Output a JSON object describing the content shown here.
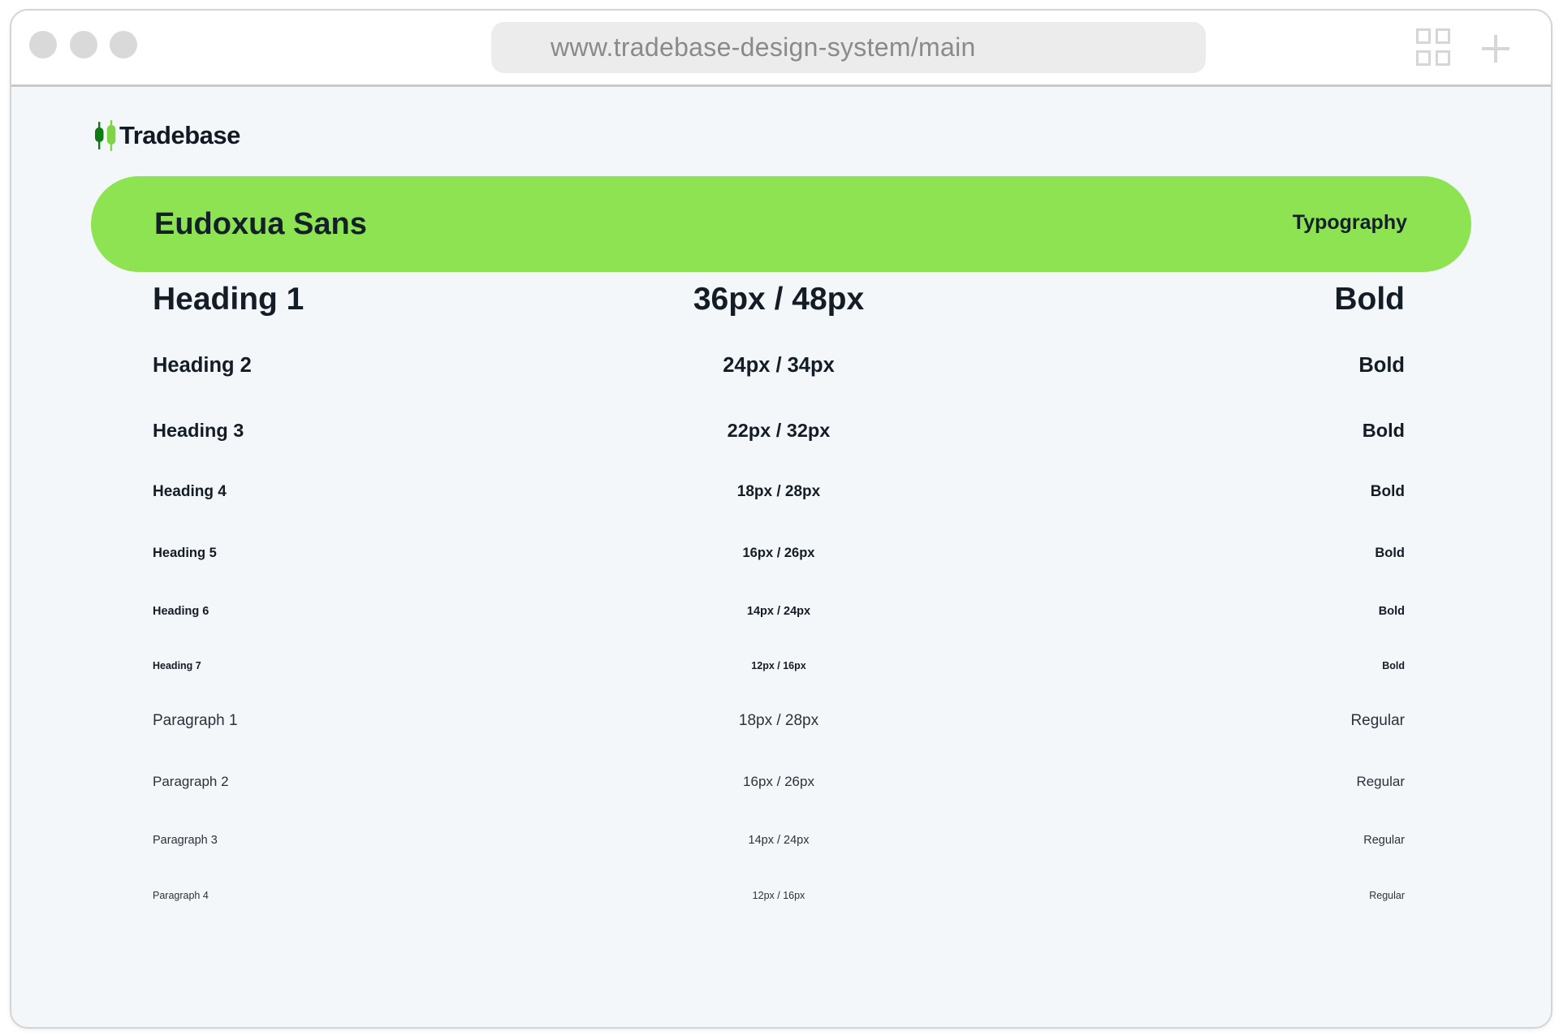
{
  "browser": {
    "url": "www.tradebase-design-system/main",
    "icons": [
      "tabs-grid-icon",
      "new-tab-plus-icon"
    ]
  },
  "brand": {
    "name": "Tradebase",
    "logo_icon": "candlestick-icon",
    "colors": {
      "accent": "#8ee352",
      "logo_dark": "#0f7a12",
      "logo_light": "#7fd548",
      "text": "#141c26"
    }
  },
  "banner": {
    "title": "Eudoxua Sans",
    "tag": "Typography"
  },
  "type_scale": [
    {
      "name": "Heading 1",
      "size": "36px / 48px",
      "weight": "Bold"
    },
    {
      "name": "Heading 2",
      "size": "24px / 34px",
      "weight": "Bold"
    },
    {
      "name": "Heading 3",
      "size": "22px / 32px",
      "weight": "Bold"
    },
    {
      "name": "Heading 4",
      "size": "18px / 28px",
      "weight": "Bold"
    },
    {
      "name": "Heading 5",
      "size": "16px / 26px",
      "weight": "Bold"
    },
    {
      "name": "Heading 6",
      "size": "14px / 24px",
      "weight": "Bold"
    },
    {
      "name": "Heading 7",
      "size": "12px / 16px",
      "weight": "Bold"
    },
    {
      "name": "Paragraph 1",
      "size": "18px / 28px",
      "weight": "Regular"
    },
    {
      "name": "Paragraph 2",
      "size": "16px / 26px",
      "weight": "Regular"
    },
    {
      "name": "Paragraph 3",
      "size": "14px / 24px",
      "weight": "Regular"
    },
    {
      "name": "Paragraph 4",
      "size": "12px / 16px",
      "weight": "Regular"
    }
  ]
}
